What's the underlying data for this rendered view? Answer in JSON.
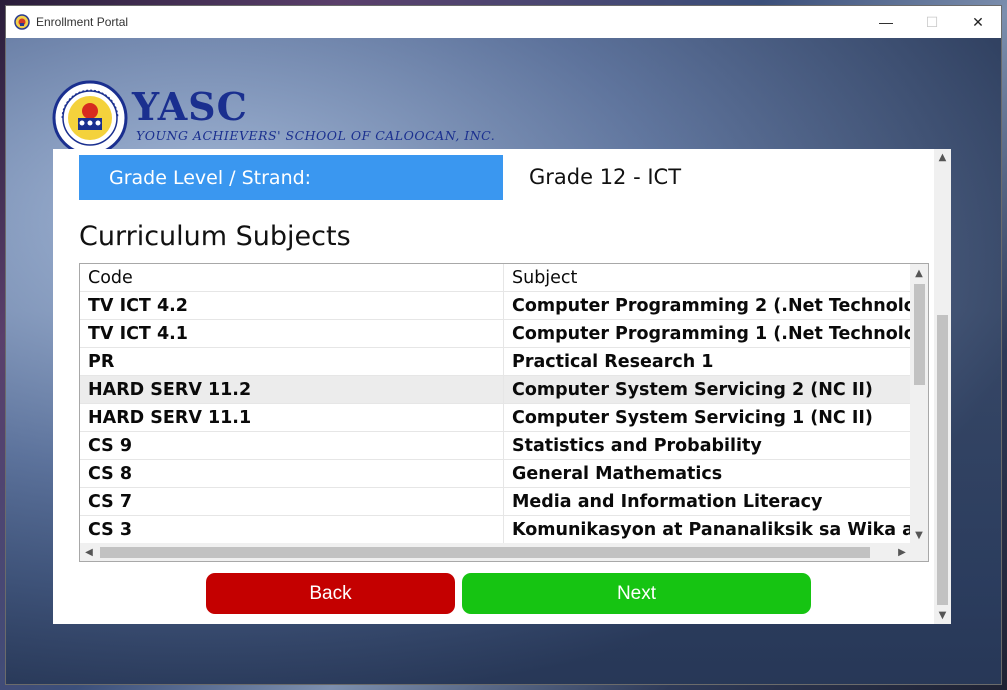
{
  "window": {
    "title": "Enrollment Portal",
    "controls": {
      "minimize": "—",
      "maximize": "☐",
      "close": "✕"
    }
  },
  "logo": {
    "name": "YASC",
    "subtitle": "YOUNG ACHIEVERS' SCHOOL OF CALOOCAN, INC.",
    "seal_text": "YOUNG ACHIEVERS' SCHOOL OF CALOOCAN",
    "seal_year": "2003"
  },
  "grade": {
    "label": "Grade Level / Strand:",
    "value": "Grade 12 - ICT"
  },
  "curriculum": {
    "title": "Curriculum Subjects",
    "columns": {
      "code": "Code",
      "subject": "Subject"
    },
    "rows": [
      {
        "code": "TV ICT 4.2",
        "subject": "Computer Programming 2 (.Net Technolo.."
      },
      {
        "code": "TV ICT 4.1",
        "subject": "Computer Programming 1 (.Net Technolo.."
      },
      {
        "code": "PR",
        "subject": "Practical Research 1"
      },
      {
        "code": "HARD SERV 11.2",
        "subject": "Computer System Servicing 2 (NC II)"
      },
      {
        "code": "HARD SERV 11.1",
        "subject": "Computer System Servicing 1 (NC II)"
      },
      {
        "code": "CS 9",
        "subject": "Statistics and Probability"
      },
      {
        "code": "CS 8",
        "subject": "General Mathematics"
      },
      {
        "code": "CS 7",
        "subject": "Media and Information Literacy"
      },
      {
        "code": "CS 3",
        "subject": "Komunikasyon at Pananaliksik sa Wika at .."
      }
    ],
    "selected_row": 3
  },
  "buttons": {
    "back": "Back",
    "next": "Next"
  },
  "colors": {
    "label_bg": "#3a97f0",
    "back_bg": "#c40000",
    "next_bg": "#16c412",
    "logo_blue": "#1a2f8f"
  },
  "icons": {
    "app": "school-seal-icon",
    "up": "scroll-up-arrow-icon",
    "down": "scroll-down-arrow-icon",
    "left": "scroll-left-arrow-icon",
    "right": "scroll-right-arrow-icon"
  }
}
